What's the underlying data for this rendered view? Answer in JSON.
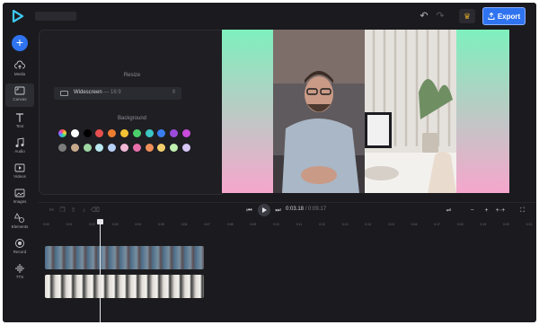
{
  "toolbar": {
    "export_label": "Export"
  },
  "sidebar": {
    "items": [
      {
        "label": "Media",
        "icon": "cloud-upload-icon"
      },
      {
        "label": "Canvas",
        "icon": "canvas-icon"
      },
      {
        "label": "Text",
        "icon": "text-icon"
      },
      {
        "label": "Audio",
        "icon": "music-note-icon"
      },
      {
        "label": "Videos",
        "icon": "video-icon"
      },
      {
        "label": "Images",
        "icon": "image-icon"
      },
      {
        "label": "Elements",
        "icon": "shapes-icon"
      },
      {
        "label": "Record",
        "icon": "record-icon"
      },
      {
        "label": "TTS",
        "icon": "waveform-icon"
      }
    ]
  },
  "panel": {
    "resize_label": "Resize",
    "aspect_name": "Widescreen",
    "aspect_ratio": "— 16:9",
    "background_label": "Background",
    "colors": [
      "#ff5a5a",
      "#ffffff",
      "#000000",
      "#e84f4f",
      "#f07c2f",
      "#f3c333",
      "#4bcf6b",
      "#3dc6c3",
      "#3a7ef0",
      "#9b4bdb",
      "#c84bdb",
      "#7d7d7d",
      "#c7a88b",
      "#9fd6a3",
      "#b9e8ee",
      "#b7d0f5",
      "#f0b7d5",
      "#e76fa9",
      "#f08f5a",
      "#f3cf6d",
      "#c0f0b0",
      "#d7c7f5"
    ]
  },
  "timeline": {
    "current_time": "0:03.18",
    "total_time": "/ 0:09.17",
    "ticks": [
      "0:00",
      "0:01",
      "0:02",
      "0:03",
      "0:04",
      "0:05",
      "0:06",
      "0:07",
      "0:08",
      "0:09",
      "0:10",
      "0:11",
      "0:12",
      "0:13",
      "0:14",
      "0:15",
      "0:16",
      "0:17",
      "0:18",
      "0:19",
      "0:20",
      "0:21"
    ]
  },
  "colors": {
    "accent": "#2f73f0",
    "background": "#1b1b1f"
  }
}
